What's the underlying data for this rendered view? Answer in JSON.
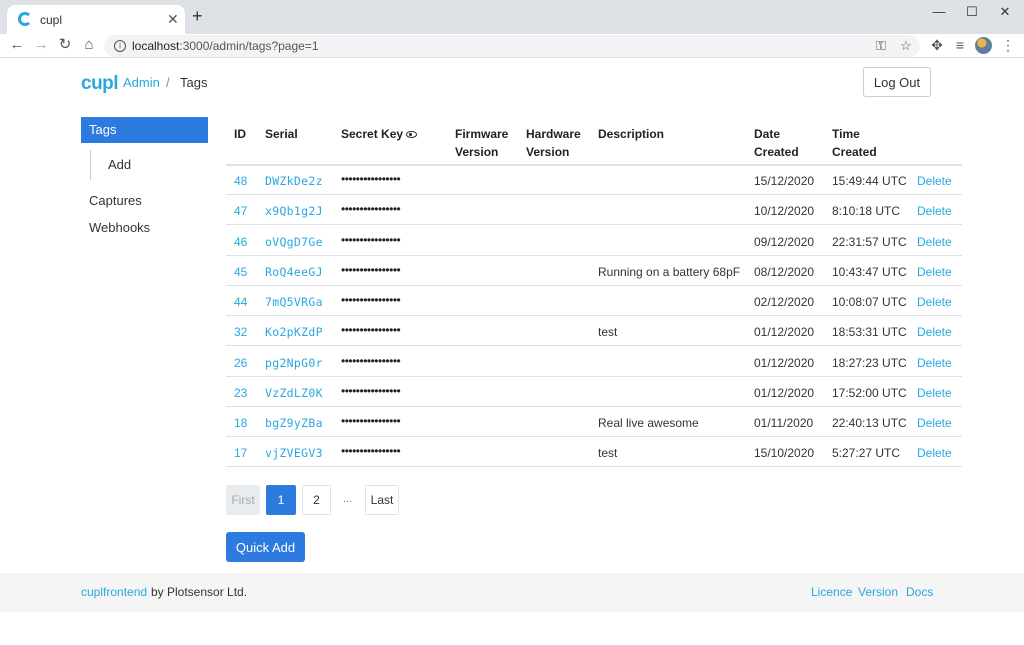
{
  "browser": {
    "tab_title": "cupl",
    "url_host": "localhost",
    "url_path": ":3000/admin/tags?page=1"
  },
  "header": {
    "logo": "cupl",
    "breadcrumb_admin": "Admin",
    "breadcrumb_sep": "/",
    "breadcrumb_current": "Tags",
    "logout": "Log Out"
  },
  "sidebar": {
    "tags": "Tags",
    "add": "Add",
    "captures": "Captures",
    "webhooks": "Webhooks"
  },
  "table": {
    "headers": {
      "id": "ID",
      "serial": "Serial",
      "secret": "Secret Key",
      "firmware_1": "Firmware",
      "firmware_2": "Version",
      "hardware_1": "Hardware",
      "hardware_2": "Version",
      "description": "Description",
      "date_1": "Date",
      "date_2": "Created",
      "time_1": "Time",
      "time_2": "Created"
    },
    "rows": [
      {
        "id": "48",
        "serial": "DWZkDe2z",
        "secret": "••••••••••••••••",
        "description": "",
        "date": "15/12/2020",
        "time": "15:49:44 UTC",
        "action": "Delete"
      },
      {
        "id": "47",
        "serial": "x9Qb1g2J",
        "secret": "••••••••••••••••",
        "description": "",
        "date": "10/12/2020",
        "time": "8:10:18 UTC",
        "action": "Delete"
      },
      {
        "id": "46",
        "serial": "oVQgD7Ge",
        "secret": "••••••••••••••••",
        "description": "",
        "date": "09/12/2020",
        "time": "22:31:57 UTC",
        "action": "Delete"
      },
      {
        "id": "45",
        "serial": "RoQ4eeGJ",
        "secret": "••••••••••••••••",
        "description": "Running on a battery 68pF",
        "date": "08/12/2020",
        "time": "10:43:47 UTC",
        "action": "Delete"
      },
      {
        "id": "44",
        "serial": "7mQ5VRGa",
        "secret": "••••••••••••••••",
        "description": "",
        "date": "02/12/2020",
        "time": "10:08:07 UTC",
        "action": "Delete"
      },
      {
        "id": "32",
        "serial": "Ko2pKZdP",
        "secret": "••••••••••••••••",
        "description": "test",
        "date": "01/12/2020",
        "time": "18:53:31 UTC",
        "action": "Delete"
      },
      {
        "id": "26",
        "serial": "pg2NpG0r",
        "secret": "••••••••••••••••",
        "description": "",
        "date": "01/12/2020",
        "time": "18:27:23 UTC",
        "action": "Delete"
      },
      {
        "id": "23",
        "serial": "VzZdLZ0K",
        "secret": "••••••••••••••••",
        "description": "",
        "date": "01/12/2020",
        "time": "17:52:00 UTC",
        "action": "Delete"
      },
      {
        "id": "18",
        "serial": "bgZ9yZBa",
        "secret": "••••••••••••••••",
        "description": "Real live awesome",
        "date": "01/11/2020",
        "time": "22:40:13 UTC",
        "action": "Delete"
      },
      {
        "id": "17",
        "serial": "vjZVEGV3",
        "secret": "••••••••••••••••",
        "description": "test",
        "date": "15/10/2020",
        "time": "5:27:27 UTC",
        "action": "Delete"
      }
    ]
  },
  "pagination": {
    "first": "First",
    "page1": "1",
    "page2": "2",
    "ellipsis": "...",
    "last": "Last"
  },
  "quick_add": "Quick Add",
  "footer": {
    "brand": "cuplfrontend",
    "by": "by Plotsensor Ltd.",
    "licence": "Licence",
    "version": "Version",
    "docs": "Docs"
  },
  "colors": {
    "accent": "#29a8e0",
    "primary": "#2d7be0"
  }
}
